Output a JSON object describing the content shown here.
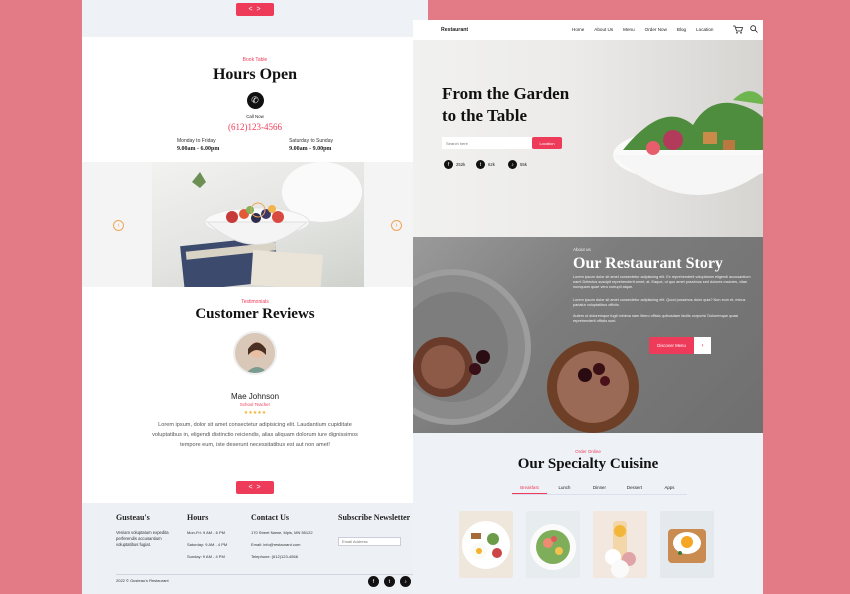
{
  "left": {
    "pager_label": "< >",
    "book_kicker": "Book Table",
    "hours_title": "Hours Open",
    "call_label": "Call Now",
    "phone": "(612)123-4566",
    "weekday_label": "Monday to Friday",
    "weekday_hours": "9.00am - 6.00pm",
    "weekend_label": "Saturday to Sunday",
    "weekend_hours": "9.00am - 9.00pm",
    "reviews_kicker": "Testimonials",
    "reviews_title": "Customer Reviews",
    "reviewer_name": "Mae Johnson",
    "reviewer_role": "School Teacher",
    "stars": "★★★★★",
    "review_text": "Lorem ipsum, dolor sit amet consectetur adipisicing elit. Laudantium cupiditate voluptatibus in, eligendi distinctio reiciendis, alias aliquam dolorum iure dignissimos tempore eum, iste deserunt necessitatibus est aut non amet!",
    "footer": {
      "brand": "Gusteau's",
      "brand_text": "Veniam voluptatum expedita perferendis accusantium voluptatibus fugiat.",
      "hours_title": "Hours",
      "hours_lines": [
        "Mon-Fri: 9 AM - 6 PM",
        "Saturday: 9 AM - 4 PM",
        "Sunday: 9 AM - 4 PM"
      ],
      "contact_title": "Contact Us",
      "contact_lines": [
        "170 Street Name, Mpls, MN 55122",
        "Email: info@restaurant.com",
        "Telephone: (612)123-4566"
      ],
      "newsletter_title": "Subscribe Newsletter",
      "email_placeholder": "Email Address",
      "copyright": "2022 © Gusteau's Restaurant",
      "social": [
        "f",
        "t",
        "♪"
      ]
    }
  },
  "right": {
    "nav": {
      "brand": "Restaurant",
      "links": [
        "Home",
        "About Us",
        "Menu",
        "Order Now",
        "Blog",
        "Location"
      ]
    },
    "hero": {
      "title_line1": "From the Garden",
      "title_line2": "to the Table",
      "search_placeholder": "Search here",
      "search_button": "Location",
      "stats": [
        {
          "icon": "f",
          "value": "252k"
        },
        {
          "icon": "t",
          "value": "62k"
        },
        {
          "icon": "♪",
          "value": "55k"
        }
      ]
    },
    "story": {
      "kicker": "About us",
      "title": "Our Restaurant Story",
      "para1": "Lorem ipsum dolor sit amet consectetur adipisicing elit. Ex reprehenderit voluptatum eligendi accusantium nam! Delectus suscipit reprehenderit amet, at. Eaque, ut quo amet possimus sed dolores maiores, vitae numquam quae vero corrupti atque.",
      "para2": "Lorem ipsum dolor sit amet consectetur adipisicing elit. Quod possimus dolor quia? Non eum et, minus pariatur voluptatibus officiis.",
      "para3": "Autem ut doloremque fugit minima nam libero officia quibusdam facilis corporis! Doloremque quasi reprehenderit officiis sunt.",
      "button": "Discover Menu",
      "button_arrow": "›"
    },
    "cuisine": {
      "kicker": "Order Online",
      "title": "Our Specialty Cuisine",
      "tabs": [
        "Breakfast",
        "Lunch",
        "Dinner",
        "Dessert",
        "Apps"
      ],
      "active_tab": "Breakfast"
    }
  },
  "colors": {
    "accent": "#ef3b5a",
    "background": "#e27b86"
  }
}
